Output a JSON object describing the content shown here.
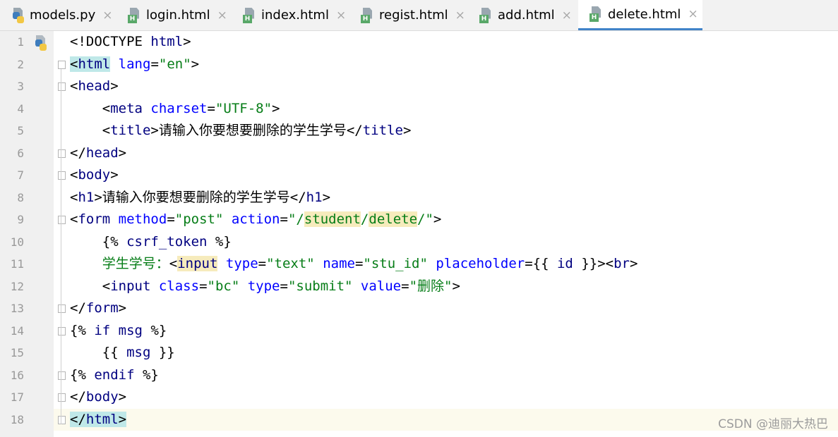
{
  "tabs": [
    {
      "label": "models.py",
      "icon": "python-file-icon",
      "active": false
    },
    {
      "label": "login.html",
      "icon": "html-file-icon",
      "active": false
    },
    {
      "label": "index.html",
      "icon": "html-file-icon",
      "active": false
    },
    {
      "label": "regist.html",
      "icon": "html-file-icon",
      "active": false
    },
    {
      "label": "add.html",
      "icon": "html-file-icon",
      "active": false
    },
    {
      "label": "delete.html",
      "icon": "html-file-icon",
      "active": true
    }
  ],
  "close_glyph": "×",
  "html_badge": "H",
  "colors": {
    "tag": "#000080",
    "attribute": "#0000ff",
    "string": "#067d17",
    "active_tab_underline": "#4083c9",
    "current_line": "#fcfaed"
  },
  "code": {
    "line_numbers": [
      "1",
      "2",
      "3",
      "4",
      "5",
      "6",
      "7",
      "8",
      "9",
      "10",
      "11",
      "12",
      "13",
      "14",
      "15",
      "16",
      "17",
      "18"
    ],
    "lines": [
      [
        {
          "c": "t",
          "v": "<!DOCTYPE "
        },
        {
          "c": "tg",
          "v": "html"
        },
        {
          "c": "t",
          "v": ">"
        }
      ],
      [
        {
          "c": "t hl-tag",
          "v": "<"
        },
        {
          "c": "tg hl-tag",
          "v": "html"
        },
        {
          "c": "t",
          "v": " "
        },
        {
          "c": "at",
          "v": "lang"
        },
        {
          "c": "t",
          "v": "="
        },
        {
          "c": "vl",
          "v": "\"en\""
        },
        {
          "c": "t",
          "v": ">"
        }
      ],
      [
        {
          "c": "t",
          "v": "<"
        },
        {
          "c": "tg",
          "v": "head"
        },
        {
          "c": "t",
          "v": ">"
        }
      ],
      [
        {
          "c": "t",
          "v": "    <"
        },
        {
          "c": "tg",
          "v": "meta"
        },
        {
          "c": "t",
          "v": " "
        },
        {
          "c": "at",
          "v": "charset"
        },
        {
          "c": "t",
          "v": "="
        },
        {
          "c": "vl",
          "v": "\"UTF-8\""
        },
        {
          "c": "t",
          "v": ">"
        }
      ],
      [
        {
          "c": "t",
          "v": "    <"
        },
        {
          "c": "tg",
          "v": "title"
        },
        {
          "c": "t",
          "v": ">请输入你要想要删除的学生学号</"
        },
        {
          "c": "tg",
          "v": "title"
        },
        {
          "c": "t",
          "v": ">"
        }
      ],
      [
        {
          "c": "t",
          "v": "</"
        },
        {
          "c": "tg",
          "v": "head"
        },
        {
          "c": "t",
          "v": ">"
        }
      ],
      [
        {
          "c": "t",
          "v": "<"
        },
        {
          "c": "tg",
          "v": "body"
        },
        {
          "c": "t",
          "v": ">"
        }
      ],
      [
        {
          "c": "t",
          "v": "<"
        },
        {
          "c": "tg",
          "v": "h1"
        },
        {
          "c": "t",
          "v": ">请输入你要想要删除的学生学号</"
        },
        {
          "c": "tg",
          "v": "h1"
        },
        {
          "c": "t",
          "v": ">"
        }
      ],
      [
        {
          "c": "t",
          "v": "<"
        },
        {
          "c": "tg",
          "v": "form"
        },
        {
          "c": "t",
          "v": " "
        },
        {
          "c": "at",
          "v": "method"
        },
        {
          "c": "t",
          "v": "="
        },
        {
          "c": "vl",
          "v": "\"post\""
        },
        {
          "c": "t",
          "v": " "
        },
        {
          "c": "at",
          "v": "action"
        },
        {
          "c": "t",
          "v": "="
        },
        {
          "c": "vl",
          "v": "\"/"
        },
        {
          "c": "vl hl-word",
          "v": "student"
        },
        {
          "c": "vl",
          "v": "/"
        },
        {
          "c": "vl hl-word",
          "v": "delete"
        },
        {
          "c": "vl",
          "v": "/\""
        },
        {
          "c": "t",
          "v": ">"
        }
      ],
      [
        {
          "c": "t",
          "v": "    {% "
        },
        {
          "c": "kw",
          "v": "csrf_token"
        },
        {
          "c": "t",
          "v": " %}"
        }
      ],
      [
        {
          "c": "vl",
          "v": "    学生学号："
        },
        {
          "c": "t",
          "v": "<"
        },
        {
          "c": "tg hl-word",
          "v": "input"
        },
        {
          "c": "t",
          "v": " "
        },
        {
          "c": "at",
          "v": "type"
        },
        {
          "c": "t",
          "v": "="
        },
        {
          "c": "vl",
          "v": "\"text\""
        },
        {
          "c": "t",
          "v": " "
        },
        {
          "c": "at",
          "v": "name"
        },
        {
          "c": "t",
          "v": "="
        },
        {
          "c": "vl",
          "v": "\"stu_id\""
        },
        {
          "c": "t",
          "v": " "
        },
        {
          "c": "at",
          "v": "placeholder"
        },
        {
          "c": "t",
          "v": "={{ "
        },
        {
          "c": "kw",
          "v": "id"
        },
        {
          "c": "t",
          "v": " }}><"
        },
        {
          "c": "tg",
          "v": "br"
        },
        {
          "c": "t",
          "v": ">"
        }
      ],
      [
        {
          "c": "t",
          "v": "    <"
        },
        {
          "c": "tg",
          "v": "input"
        },
        {
          "c": "t",
          "v": " "
        },
        {
          "c": "at",
          "v": "class"
        },
        {
          "c": "t",
          "v": "="
        },
        {
          "c": "vl",
          "v": "\"bc\""
        },
        {
          "c": "t",
          "v": " "
        },
        {
          "c": "at",
          "v": "type"
        },
        {
          "c": "t",
          "v": "="
        },
        {
          "c": "vl",
          "v": "\"submit\""
        },
        {
          "c": "t",
          "v": " "
        },
        {
          "c": "at",
          "v": "value"
        },
        {
          "c": "t",
          "v": "="
        },
        {
          "c": "vl",
          "v": "\"删除\""
        },
        {
          "c": "t",
          "v": ">"
        }
      ],
      [
        {
          "c": "t",
          "v": "</"
        },
        {
          "c": "tg",
          "v": "form"
        },
        {
          "c": "t",
          "v": ">"
        }
      ],
      [
        {
          "c": "t",
          "v": "{% "
        },
        {
          "c": "kw",
          "v": "if"
        },
        {
          "c": "t",
          "v": " "
        },
        {
          "c": "kw",
          "v": "msg"
        },
        {
          "c": "t",
          "v": " %}"
        }
      ],
      [
        {
          "c": "t",
          "v": "    {{ "
        },
        {
          "c": "kw",
          "v": "msg"
        },
        {
          "c": "t",
          "v": " }}"
        }
      ],
      [
        {
          "c": "t",
          "v": "{% "
        },
        {
          "c": "kw",
          "v": "endif"
        },
        {
          "c": "t",
          "v": " %}"
        }
      ],
      [
        {
          "c": "t",
          "v": "</"
        },
        {
          "c": "tg",
          "v": "body"
        },
        {
          "c": "t",
          "v": ">"
        }
      ],
      [
        {
          "c": "t hl-tag",
          "v": "</"
        },
        {
          "c": "tg hl-tag",
          "v": "html"
        },
        {
          "c": "t hl-tag",
          "v": ">"
        }
      ]
    ]
  },
  "watermark": "CSDN @迪丽大热巴"
}
